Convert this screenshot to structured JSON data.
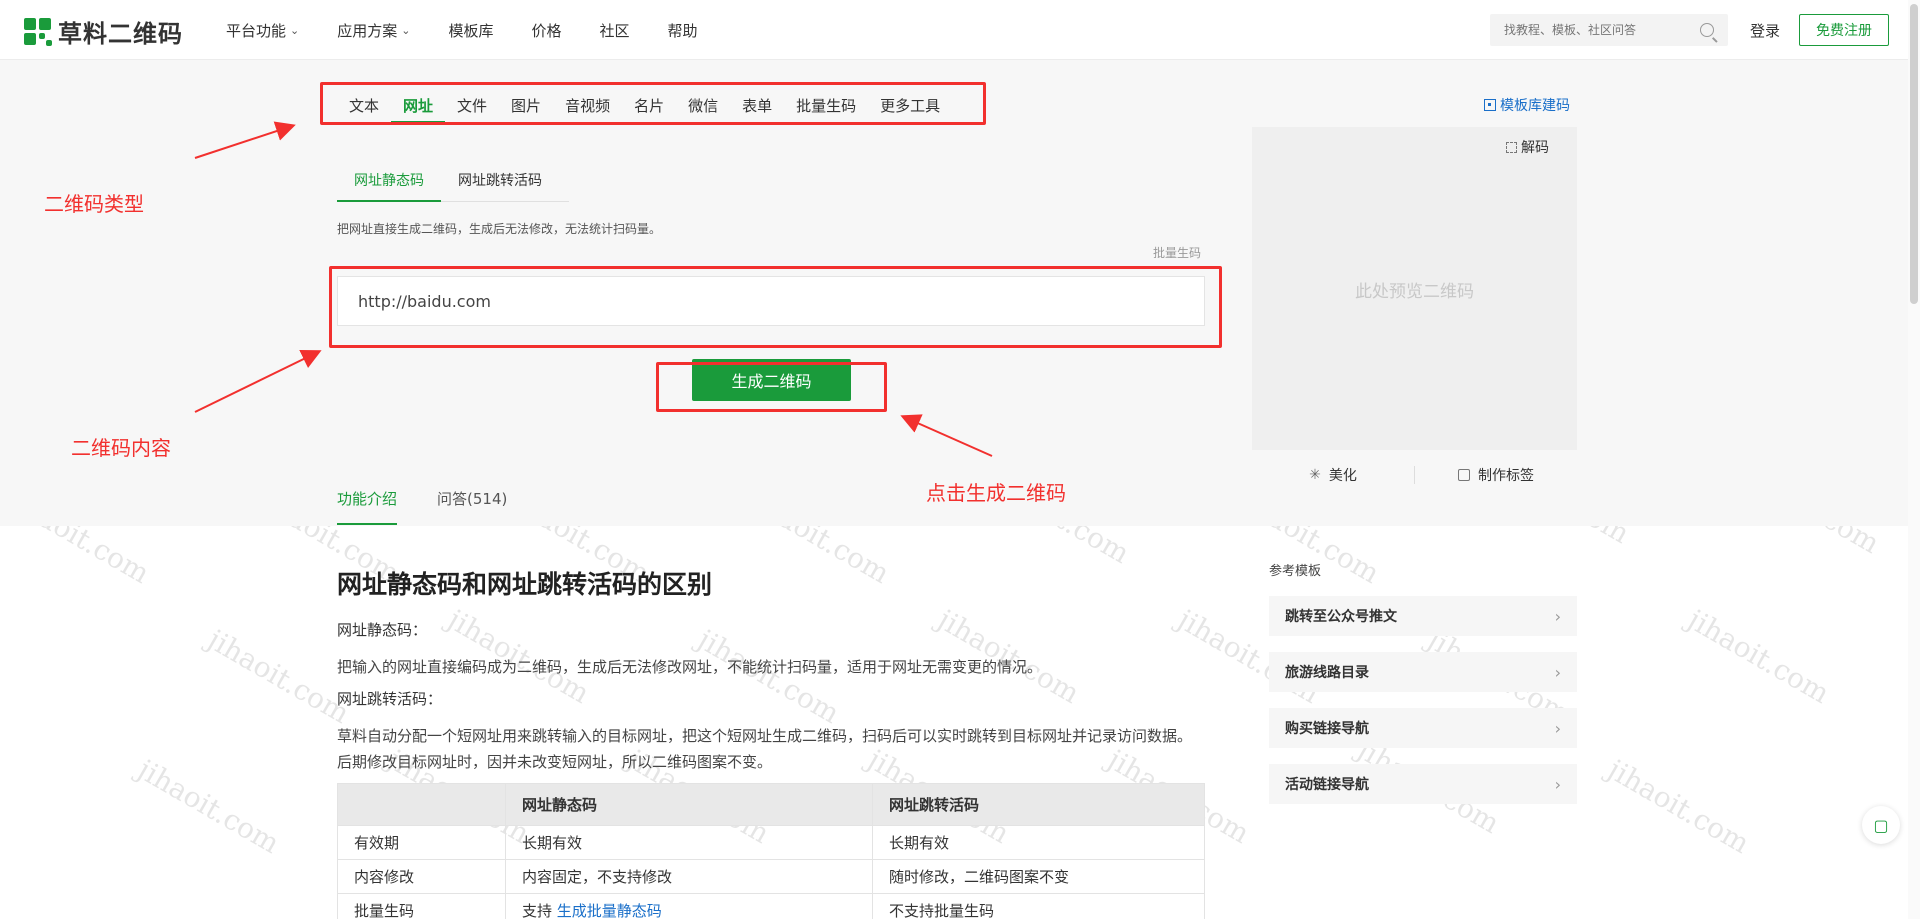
{
  "brand": {
    "name": "草料二维码"
  },
  "nav": [
    {
      "label": "平台功能",
      "dropdown": true
    },
    {
      "label": "应用方案",
      "dropdown": true
    },
    {
      "label": "模板库",
      "dropdown": false
    },
    {
      "label": "价格",
      "dropdown": false
    },
    {
      "label": "社区",
      "dropdown": false
    },
    {
      "label": "帮助",
      "dropdown": false
    }
  ],
  "search": {
    "placeholder": "找教程、模板、社区问答"
  },
  "auth": {
    "login": "登录",
    "register": "免费注册"
  },
  "type_tabs": [
    "文本",
    "网址",
    "文件",
    "图片",
    "音视频",
    "名片",
    "微信",
    "表单",
    "批量生码",
    "更多工具"
  ],
  "type_tabs_active": "网址",
  "sub_tabs": [
    "网址静态码",
    "网址跳转活码"
  ],
  "hint": "把网址直接生成二维码，生成后无法修改，无法统计扫码量。",
  "batch_link": "批量生码",
  "url_input": {
    "value": "http://baidu.com"
  },
  "generate_button": "生成二维码",
  "annotations": {
    "type": "二维码类型",
    "content": "二维码内容",
    "click": "点击生成二维码"
  },
  "template_link": "模板库建码",
  "preview": {
    "decode": "解码",
    "placeholder": "此处预览二维码",
    "beautify": "美化",
    "label": "制作标签"
  },
  "info_tabs": [
    "功能介绍",
    "问答(514)"
  ],
  "article": {
    "title": "网址静态码和网址跳转活码的区别",
    "static_label": "网址静态码：",
    "static_desc": "把输入的网址直接编码成为二维码，生成后无法修改网址，不能统计扫码量，适用于网址无需变更的情况。",
    "dynamic_label": "网址跳转活码：",
    "dynamic_desc": "草料自动分配一个短网址用来跳转输入的目标网址，把这个短网址生成二维码，扫码后可以实时跳转到目标网址并记录访问数据。后期修改目标网址时，因并未改变短网址，所以二维码图案不变。",
    "table": {
      "headers": [
        "",
        "网址静态码",
        "网址跳转活码"
      ],
      "rows": [
        [
          "有效期",
          "长期有效",
          "长期有效"
        ],
        [
          "内容修改",
          "内容固定，不支持修改",
          "随时修改，二维码图案不变"
        ],
        [
          "批量生码",
          "支持",
          "不支持批量生码"
        ]
      ],
      "batch_link": "生成批量静态码"
    }
  },
  "reference": {
    "title": "参考模板",
    "items": [
      "跳转至公众号推文",
      "旅游线路目录",
      "购买链接导航",
      "活动链接导航"
    ]
  },
  "watermark": "jihaoit.com",
  "colors": {
    "brand_green": "#1a9b3b",
    "annotation_red": "#f2302e",
    "link_blue": "#1a6fc9"
  }
}
